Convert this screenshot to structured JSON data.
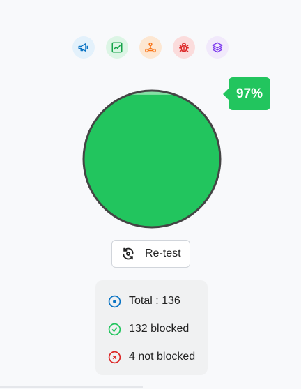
{
  "toolbar": {
    "icons": [
      {
        "name": "megaphone-icon",
        "color": "#0b74c4"
      },
      {
        "name": "chart-icon",
        "color": "#16a34a"
      },
      {
        "name": "network-icon",
        "color": "#f97316"
      },
      {
        "name": "bug-icon",
        "color": "#dc2626"
      },
      {
        "name": "layers-icon",
        "color": "#7c3aed"
      }
    ]
  },
  "gauge": {
    "percent_label": "97%",
    "fill_fraction": 0.97,
    "fill_color": "#22c55e",
    "empty_color": "#86dfa5"
  },
  "retest": {
    "label": "Re-test"
  },
  "stats": {
    "total": "Total : 136",
    "blocked": "132 blocked",
    "not_blocked": "4 not blocked"
  }
}
